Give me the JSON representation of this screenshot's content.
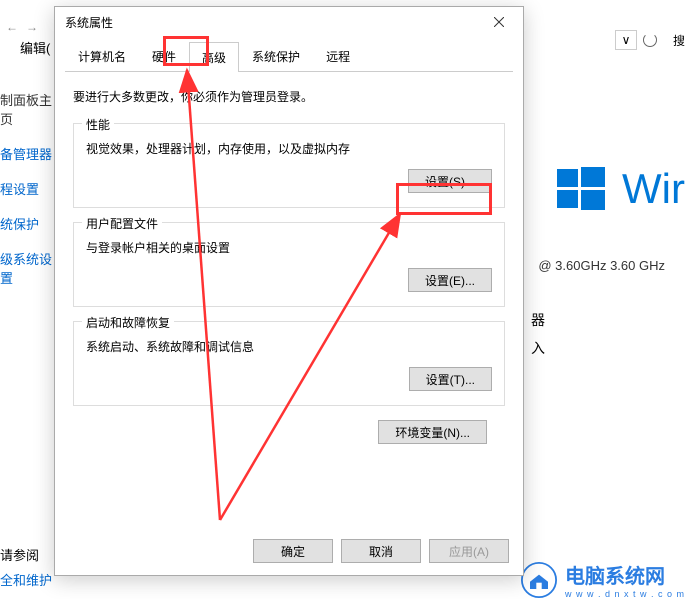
{
  "bg": {
    "nav_back": "←",
    "nav_fwd": "→",
    "edit": "编辑(",
    "sidebar": [
      "制面板主页",
      "备管理器",
      "程设置",
      "统保护",
      "级系统设置"
    ],
    "search_placeholder": "搜",
    "dropdown": "∨",
    "win_text": "Wir",
    "cpu": "@ 3.60GHz   3.60 GHz",
    "misc1": "器",
    "misc2": "入",
    "footer1": "请参阅",
    "footer2": "全和维护",
    "site_name": "电脑系统网",
    "site_url": "w w w . d n x t w . c o m"
  },
  "dialog": {
    "title": "系统属性",
    "tabs": [
      "计算机名",
      "硬件",
      "高级",
      "系统保护",
      "远程"
    ],
    "active_tab_index": 2,
    "instruction": "要进行大多数更改，你必须作为管理员登录。",
    "perf": {
      "title": "性能",
      "desc": "视觉效果，处理器计划，内存使用，以及虚拟内存",
      "button": "设置(S)..."
    },
    "profile": {
      "title": "用户配置文件",
      "desc": "与登录帐户相关的桌面设置",
      "button": "设置(E)..."
    },
    "startup": {
      "title": "启动和故障恢复",
      "desc": "系统启动、系统故障和调试信息",
      "button": "设置(T)..."
    },
    "env_button": "环境变量(N)...",
    "ok": "确定",
    "cancel": "取消",
    "apply": "应用(A)"
  }
}
